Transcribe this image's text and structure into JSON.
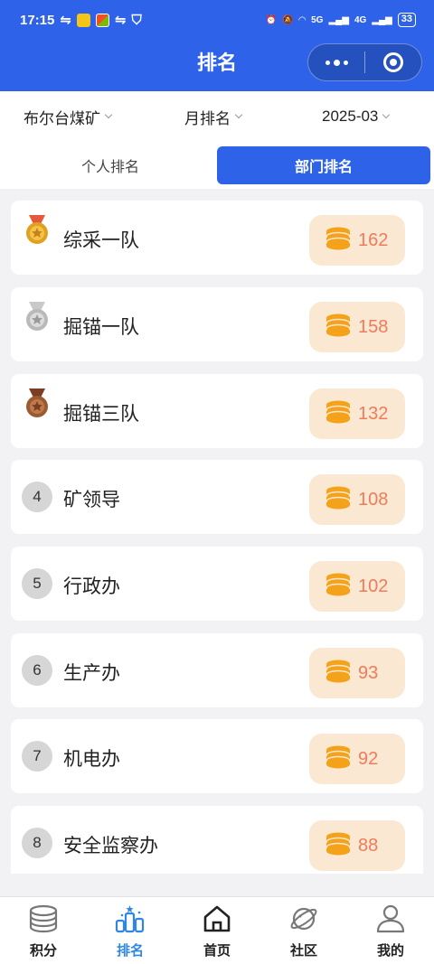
{
  "status_bar": {
    "time": "17:15",
    "battery": "33",
    "net_a": "5G",
    "net_b": "4G"
  },
  "header": {
    "title": "排名"
  },
  "filters": {
    "mine": "布尔台煤矿",
    "period": "月排名",
    "month": "2025-03"
  },
  "tabs": [
    {
      "label": "个人排名",
      "active": false
    },
    {
      "label": "部门排名",
      "active": true
    }
  ],
  "ranking": [
    {
      "rank": "1",
      "name": "综采一队",
      "points": "162",
      "medal": "gold"
    },
    {
      "rank": "2",
      "name": "掘锚一队",
      "points": "158",
      "medal": "silver"
    },
    {
      "rank": "3",
      "name": "掘锚三队",
      "points": "132",
      "medal": "bronze"
    },
    {
      "rank": "4",
      "name": "矿领导",
      "points": "108"
    },
    {
      "rank": "5",
      "name": "行政办",
      "points": "102"
    },
    {
      "rank": "6",
      "name": "生产办",
      "points": "93"
    },
    {
      "rank": "7",
      "name": "机电办",
      "points": "92"
    },
    {
      "rank": "8",
      "name": "安全监察办",
      "points": "88"
    }
  ],
  "bottom_nav": [
    {
      "label": "积分",
      "icon": "coins-icon"
    },
    {
      "label": "排名",
      "icon": "ranking-icon",
      "active": true
    },
    {
      "label": "首页",
      "icon": "home-icon"
    },
    {
      "label": "社区",
      "icon": "planet-icon"
    },
    {
      "label": "我的",
      "icon": "profile-icon"
    }
  ],
  "colors": {
    "primary": "#2e63e9",
    "points_text": "#ef7b5a",
    "points_bg": "#fbe8d2",
    "coin": "#f4a21a",
    "gold": "#e0a020",
    "silver": "#b9b9b9",
    "bronze": "#9a5a32"
  }
}
